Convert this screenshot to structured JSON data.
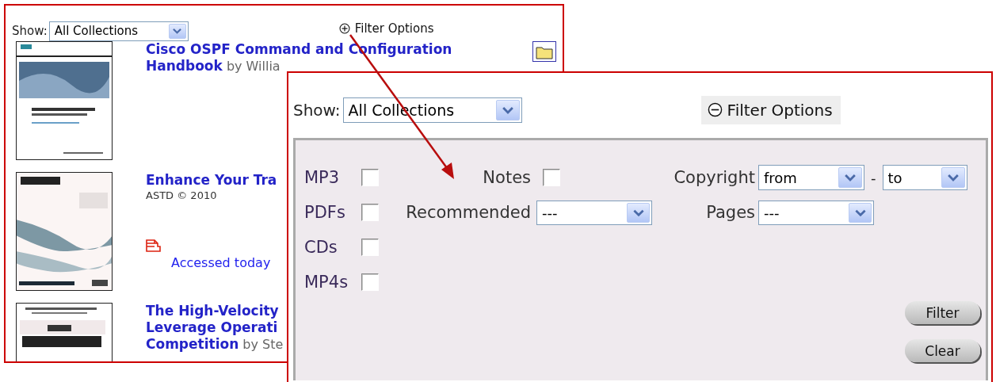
{
  "background_page": {
    "show_label": "Show:",
    "collection_select": {
      "value": "All Collections"
    },
    "filter_toggle": {
      "label": "Filter Options",
      "expanded": false
    },
    "books": [
      {
        "cover": {
          "kind": "picture"
        },
        "title_lines": [
          "Cisco OSPF Command and Configuration",
          "Handbook"
        ],
        "byline": "by Willia",
        "in_folder": true
      },
      {
        "cover": {
          "kind": "picture"
        },
        "title_lines": [
          "Enhance Your Tra"
        ],
        "publisher": "ASTD © 2010",
        "access": {
          "label": "Accessed today"
        }
      },
      {
        "cover": {
          "kind": "picture"
        },
        "title_lines": [
          "The High-Velocity",
          "Leverage Operati",
          "Competition"
        ],
        "byline": "by Ste"
      }
    ]
  },
  "filter_panel": {
    "show_label": "Show:",
    "collection_select": {
      "value": "All Collections"
    },
    "filter_toggle": {
      "label": "Filter Options",
      "expanded": true
    },
    "format_checkboxes": [
      {
        "label": "MP3",
        "checked": false
      },
      {
        "label": "PDFs",
        "checked": false
      },
      {
        "label": "CDs",
        "checked": false
      },
      {
        "label": "MP4s",
        "checked": false
      }
    ],
    "notes": {
      "label": "Notes",
      "checked": false
    },
    "recommended": {
      "label": "Recommended",
      "value": "---"
    },
    "copyright": {
      "label": "Copyright",
      "from": "from",
      "separator": "-",
      "to": "to"
    },
    "pages": {
      "label": "Pages",
      "value": "---"
    },
    "buttons": [
      "Filter",
      "Clear"
    ]
  }
}
